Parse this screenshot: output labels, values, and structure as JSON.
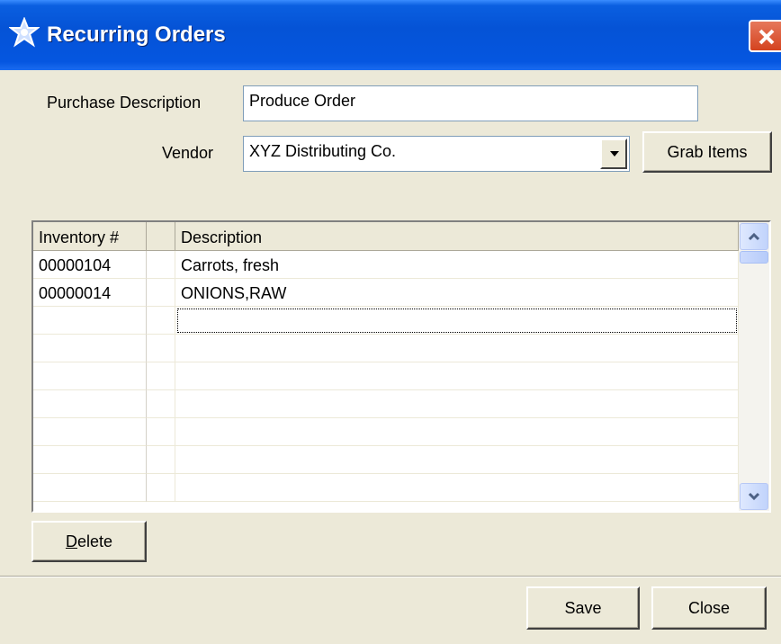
{
  "window": {
    "title": "Recurring Orders",
    "title_icon": "star-app-icon",
    "close_icon": "close-x-icon"
  },
  "form": {
    "purchase_description_label": "Purchase Description",
    "purchase_description_value": "Produce Order",
    "vendor_label": "Vendor",
    "vendor_value": "XYZ Distributing Co.",
    "grab_items_label": "Grab Items"
  },
  "grid": {
    "columns": [
      "Inventory #",
      "",
      "Description"
    ],
    "rows": [
      {
        "inventory": "00000104",
        "extra": "",
        "description": "Carrots, fresh"
      },
      {
        "inventory": "00000014",
        "extra": "",
        "description": "ONIONS,RAW"
      },
      {
        "inventory": "",
        "extra": "",
        "description": ""
      },
      {
        "inventory": "",
        "extra": "",
        "description": ""
      },
      {
        "inventory": "",
        "extra": "",
        "description": ""
      },
      {
        "inventory": "",
        "extra": "",
        "description": ""
      },
      {
        "inventory": "",
        "extra": "",
        "description": ""
      },
      {
        "inventory": "",
        "extra": "",
        "description": ""
      },
      {
        "inventory": "",
        "extra": "",
        "description": ""
      }
    ]
  },
  "buttons": {
    "delete_mnemonic": "D",
    "delete_rest": "elete",
    "save": "Save",
    "close": "Close"
  },
  "colors": {
    "titlebar": "#0553d6",
    "face": "#ece9d8",
    "close_button": "#d4431f"
  }
}
